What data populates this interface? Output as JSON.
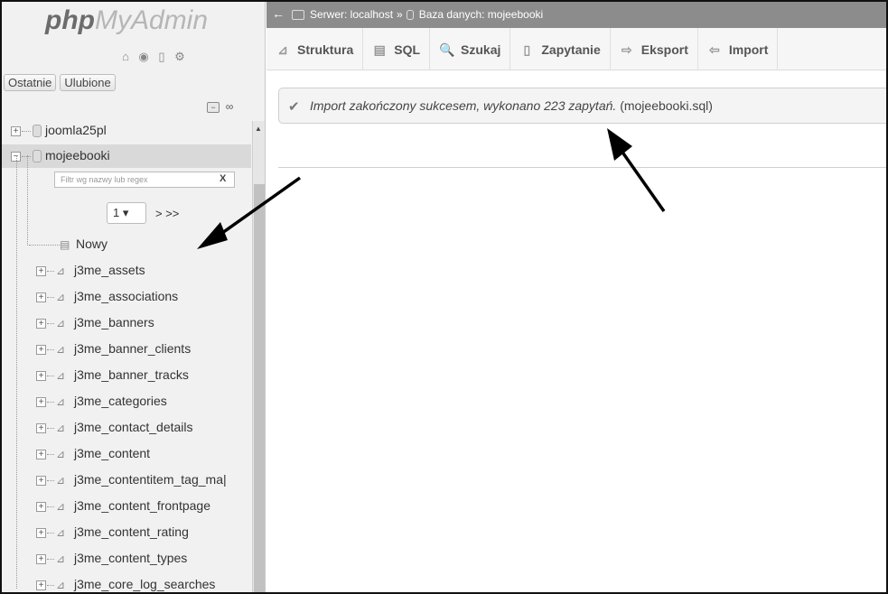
{
  "logo": {
    "php": "php",
    "myadmin": "MyAdmin"
  },
  "nav_icons": [
    "home-icon",
    "info-icon",
    "docs-icon",
    "settings-icon"
  ],
  "sidebar_tabs": {
    "recent": "Ostatnie",
    "favorites": "Ulubione"
  },
  "tree": {
    "databases": [
      {
        "name": "joomla25pl",
        "expanded": false
      },
      {
        "name": "mojeebooki",
        "expanded": true
      }
    ],
    "filter_placeholder": "Filtr wg nazwy lub regex",
    "filter_clear": "X",
    "page": "1 ▾",
    "page_next": "> >>",
    "new_label": "Nowy",
    "tables": [
      "j3me_assets",
      "j3me_associations",
      "j3me_banners",
      "j3me_banner_clients",
      "j3me_banner_tracks",
      "j3me_categories",
      "j3me_contact_details",
      "j3me_content",
      "j3me_contentitem_tag_ma|",
      "j3me_content_frontpage",
      "j3me_content_rating",
      "j3me_content_types",
      "j3me_core_log_searches"
    ]
  },
  "breadcrumb": {
    "server": "Serwer: localhost",
    "separator": "»",
    "database": "Baza danych: mojeebooki"
  },
  "tabs": [
    {
      "label": "Struktura",
      "icon": "structure-icon",
      "glyph": "⊿"
    },
    {
      "label": "SQL",
      "icon": "sql-icon",
      "glyph": "▤"
    },
    {
      "label": "Szukaj",
      "icon": "search-icon",
      "glyph": "🔍"
    },
    {
      "label": "Zapytanie",
      "icon": "query-icon",
      "glyph": "▯"
    },
    {
      "label": "Eksport",
      "icon": "export-icon",
      "glyph": "⇨"
    },
    {
      "label": "Import",
      "icon": "import-icon",
      "glyph": "⇦"
    }
  ],
  "message": {
    "text": "Import zakończony sukcesem, wykonano 223 zapytań.",
    "file": "(mojeebooki.sql)"
  },
  "colors": {
    "breadcrumb_bg": "#8c8c8c",
    "sidebar_bg": "#f1f1f1",
    "selected_row": "#d9d9d9"
  }
}
